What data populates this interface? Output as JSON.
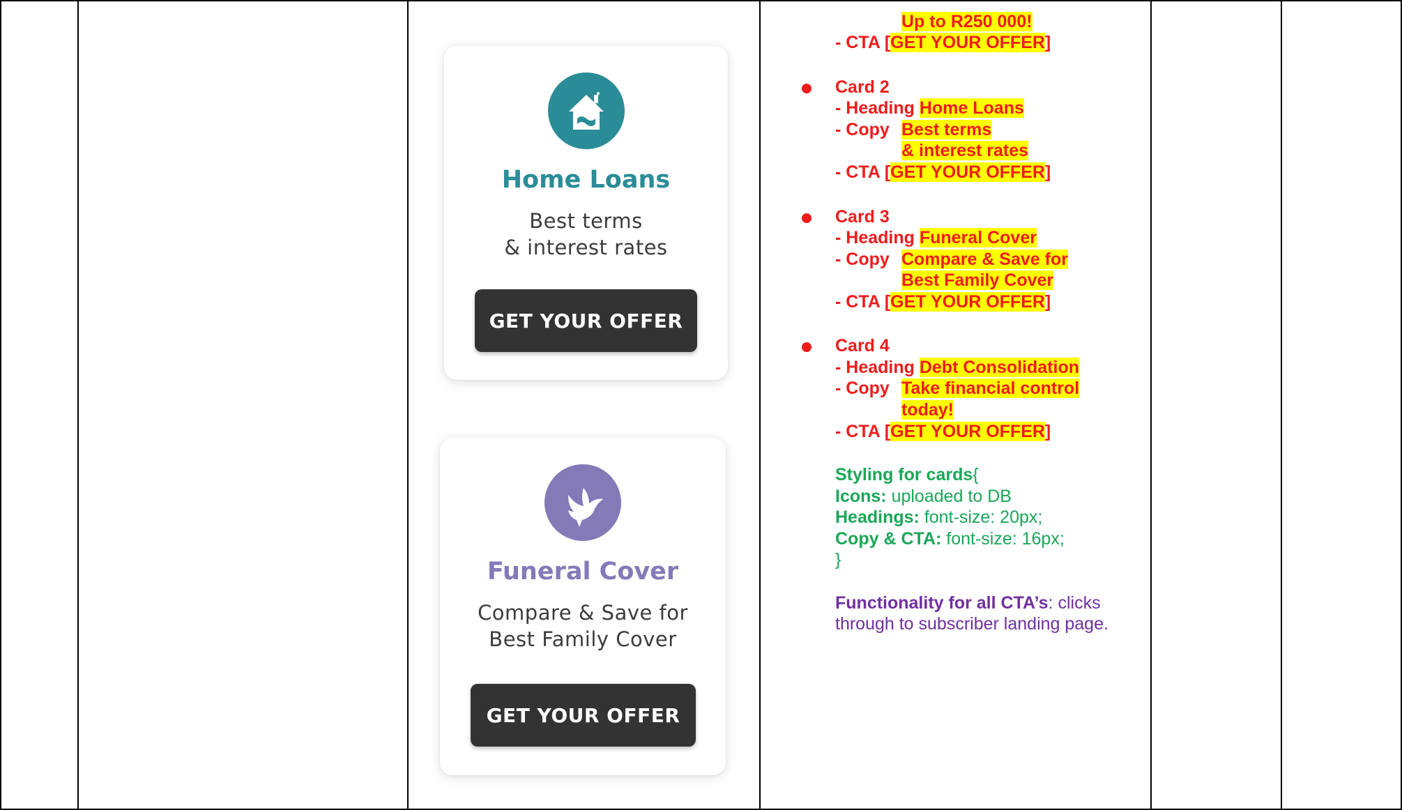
{
  "cards": [
    {
      "icon": "house-icon",
      "color": "#2a8c96",
      "heading": "Home Loans",
      "copy": [
        "Best terms",
        "& interest rates"
      ],
      "cta": "GET YOUR OFFER"
    },
    {
      "icon": "dove-icon",
      "color": "#857ab8",
      "heading": "Funeral Cover",
      "copy": [
        "Compare & Save for",
        "Best Family Cover"
      ],
      "cta": "GET YOUR OFFER"
    }
  ],
  "spec": {
    "card1_tail": {
      "copy_cont": "Up to R250 000!",
      "cta_prefix": "- CTA [",
      "cta_value": "GET YOUR OFFER",
      "cta_suffix": "]"
    },
    "card2": {
      "title": "Card 2",
      "heading_prefix": "- Heading ",
      "heading_value": "Home Loans",
      "copy_prefix": "- Copy",
      "copy_lines": [
        "Best terms",
        "& interest rates"
      ],
      "cta_prefix": "- CTA [",
      "cta_value": "GET YOUR OFFER",
      "cta_suffix": "]"
    },
    "card3": {
      "title": "Card 3",
      "heading_prefix": "- Heading ",
      "heading_value": "Funeral Cover",
      "copy_prefix": "- Copy",
      "copy_lines": [
        "Compare & Save for",
        "Best Family Cover"
      ],
      "cta_prefix": "- CTA [",
      "cta_value": "GET YOUR OFFER",
      "cta_suffix": "]"
    },
    "card4": {
      "title": "Card 4",
      "heading_prefix": "- Heading ",
      "heading_value": "Debt Consolidation",
      "copy_prefix": "- Copy",
      "copy_lines": [
        "Take financial control",
        "today!"
      ],
      "cta_prefix": "- CTA [",
      "cta_value": "GET YOUR OFFER",
      "cta_suffix": "]"
    },
    "styling": {
      "title": "Styling for cards",
      "open_brace": "{",
      "icons_label": "Icons:",
      "icons_value": " uploaded to DB",
      "headings_label": "Headings:",
      "headings_value": " font-size: 20px;",
      "copy_label": "Copy & CTA:",
      "copy_value": " font-size: 16px;",
      "close_brace": "}"
    },
    "functionality": {
      "label": "Functionality for all CTA’s",
      "line1": ": clicks",
      "line2": "through to subscriber landing page."
    }
  }
}
